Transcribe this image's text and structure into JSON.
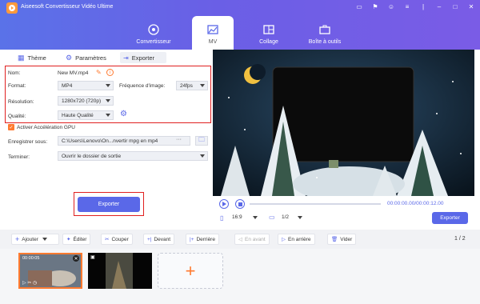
{
  "app": {
    "title": "Aiseesoft Convertisseur Vidéo Ultime"
  },
  "colors": {
    "accent": "#5a68e8",
    "highlight": "#e02020",
    "orange": "#ff7a30"
  },
  "nav": {
    "tabs": [
      {
        "label": "Convertisseur"
      },
      {
        "label": "MV"
      },
      {
        "label": "Collage"
      },
      {
        "label": "Boîte à outils"
      }
    ]
  },
  "subtabs": {
    "theme": "Thème",
    "settings": "Paramètres",
    "export": "Exporter"
  },
  "form": {
    "name_label": "Nom:",
    "name_value": "New MV.mp4",
    "format_label": "Format:",
    "format_value": "MP4",
    "fps_label": "Fréquence d'image:",
    "fps_value": "24fps",
    "resolution_label": "Résolution:",
    "resolution_value": "1280x720 (720p)",
    "quality_label": "Qualité:",
    "quality_value": "Haute Qualité",
    "gpu_label": "Activer Accélération GPU",
    "save_label": "Enregistrer sous:",
    "save_value": "C:\\Users\\Lenovo\\On...nvertir mpg en mp4",
    "finish_label": "Terminer:",
    "finish_value": "Ouvrir le dossier de sortie",
    "save_more": "···"
  },
  "export_button": "Exporter",
  "player": {
    "time": "00:00:00.00/00:00:12.00",
    "ratio": "16:9",
    "page": "1/2",
    "export": "Exporter"
  },
  "toolbar": {
    "add": "Ajouter",
    "edit": "Éditer",
    "cut": "Couper",
    "ahead": "Devant",
    "behind": "Derrière",
    "forward": "En avant",
    "backward": "En arrière",
    "clear": "Vider",
    "page": "1 / 2"
  },
  "clips": {
    "thumb1_time": "00:00:05"
  }
}
